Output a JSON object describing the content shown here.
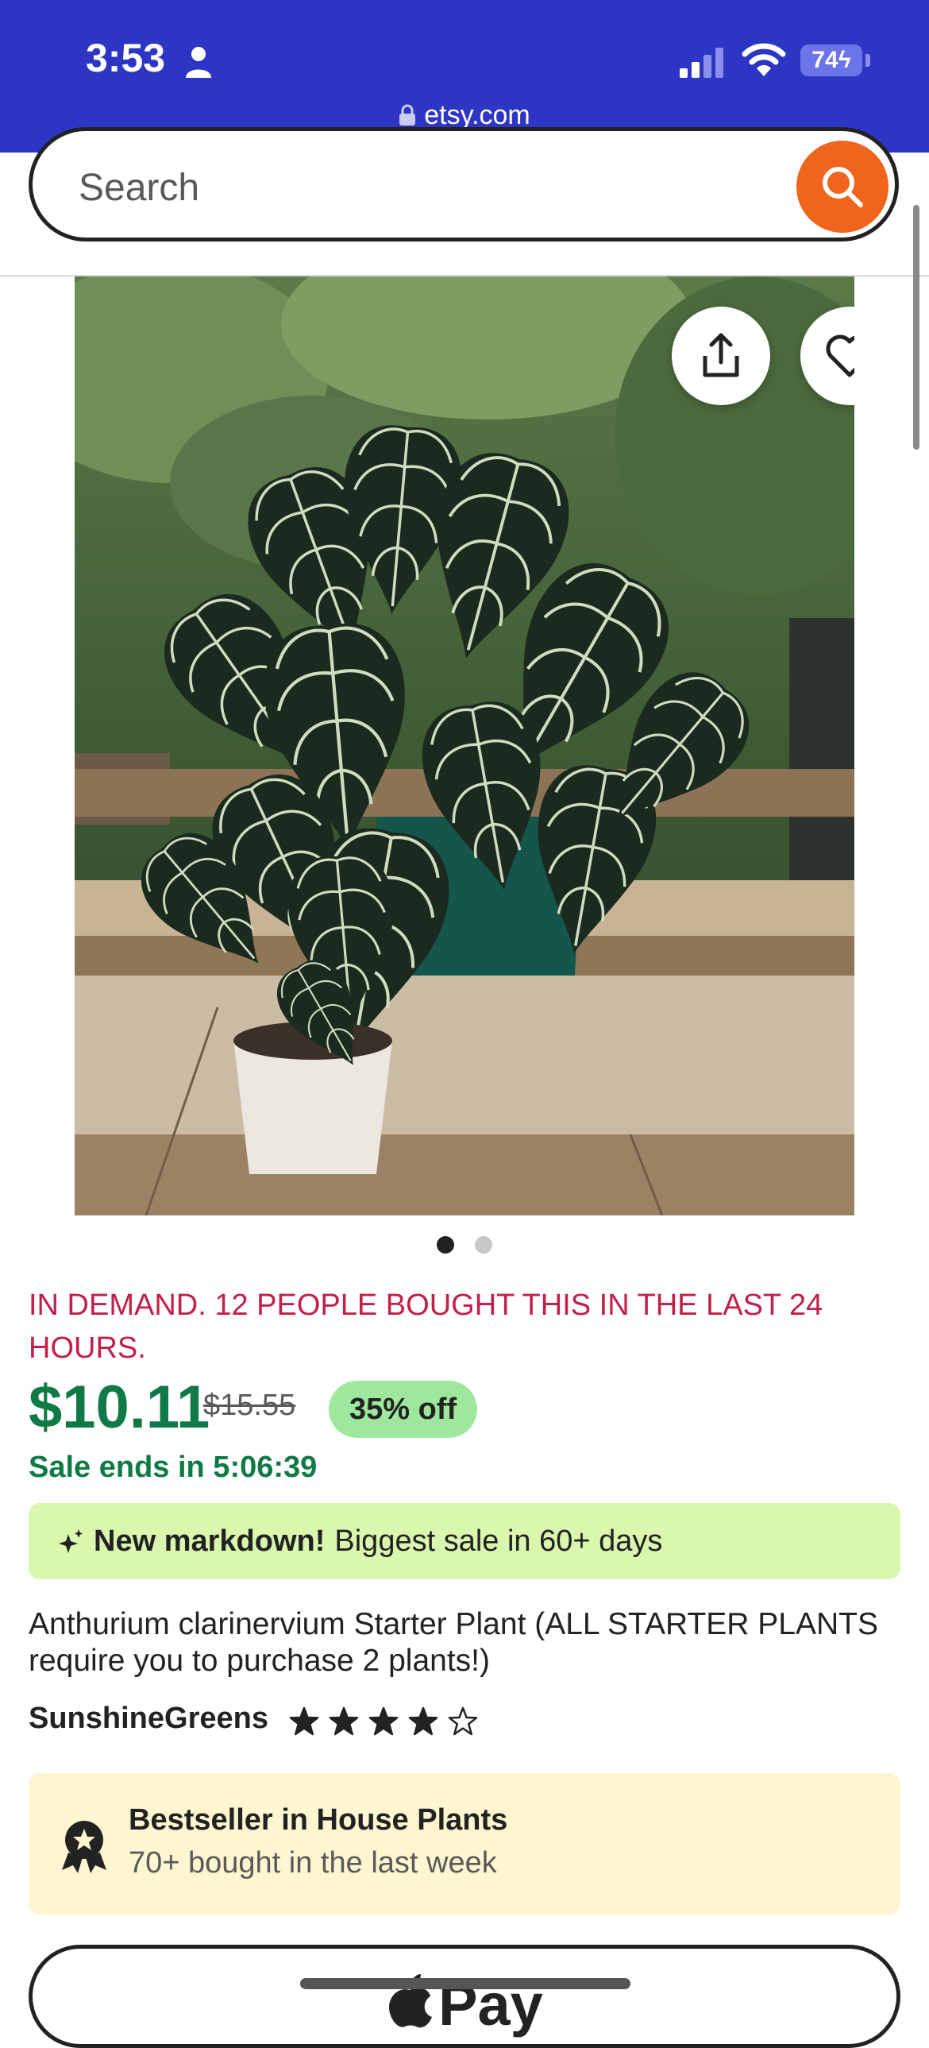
{
  "status_bar": {
    "time": "3:53",
    "battery": "74",
    "url": "etsy.com"
  },
  "search": {
    "placeholder": "Search"
  },
  "product": {
    "demand_banner": "IN DEMAND. 12 PEOPLE BOUGHT THIS IN THE LAST 24 HOURS.",
    "price": "$10.11",
    "original_price": "$15.55",
    "discount": "35% off",
    "sale_ends": "Sale ends in 5:06:39",
    "markdown_bold": "New markdown!",
    "markdown_text": "Biggest sale in 60+ days",
    "title": "Anthurium clarinervium Starter Plant (ALL STARTER PLANTS require you to purchase 2 plants!)",
    "shop": "SunshineGreens",
    "rating_stars": 4,
    "rating_max": 5,
    "image_count": 2,
    "active_image": 1
  },
  "bestseller": {
    "title": "Bestseller in House Plants",
    "subtitle": "70+ bought in the last week"
  },
  "pay_button": {
    "label": "Pay"
  },
  "colors": {
    "header_blue": "#2d35c4",
    "etsy_orange": "#f1641e",
    "price_green": "#0f7a45",
    "demand_red": "#c0204a",
    "discount_bg": "#9ee89e",
    "markdown_bg": "#daf7ae",
    "bestseller_bg": "#fdf6d0"
  },
  "icons": [
    "person-icon",
    "signal-icon",
    "wifi-icon",
    "lock-icon",
    "search-icon",
    "share-icon",
    "heart-icon",
    "sparkle-icon",
    "star-icon",
    "award-icon",
    "apple-icon"
  ]
}
